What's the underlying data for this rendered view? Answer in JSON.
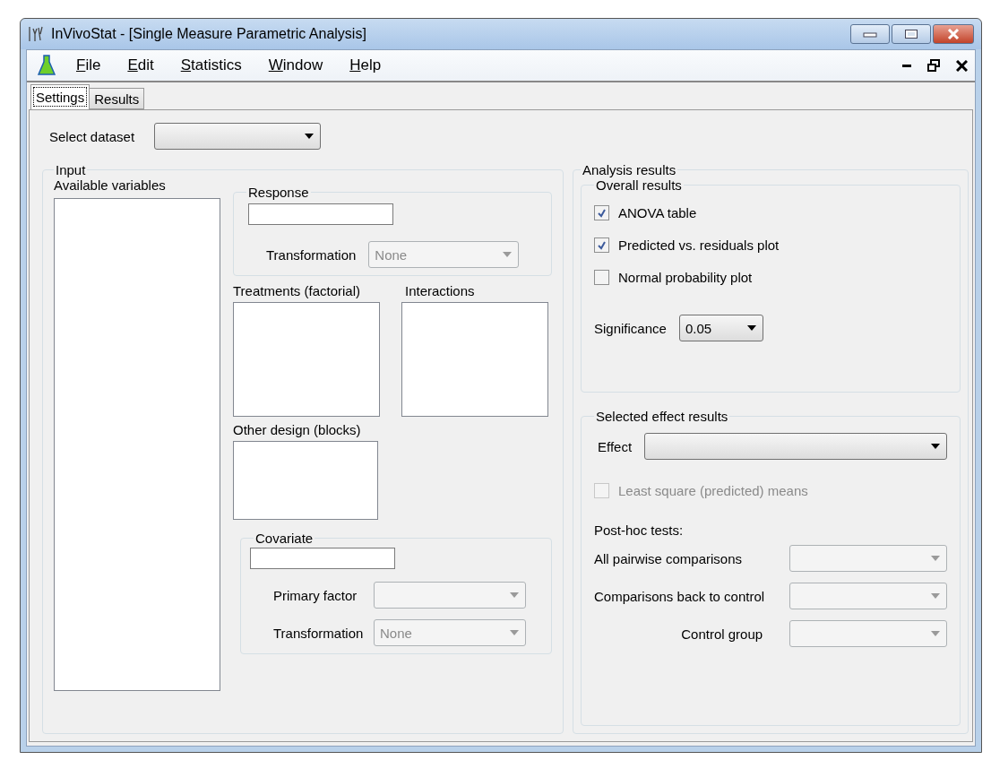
{
  "window": {
    "title": "InVivoStat - [Single Measure Parametric Analysis]"
  },
  "menu": [
    {
      "label": "File"
    },
    {
      "label": "Edit"
    },
    {
      "label": "Statistics"
    },
    {
      "label": "Window"
    },
    {
      "label": "Help"
    }
  ],
  "tabs": [
    {
      "label": "Settings",
      "selected": true
    },
    {
      "label": "Results",
      "selected": false
    }
  ],
  "select_dataset": {
    "label": "Select dataset",
    "disabled": false
  },
  "input": {
    "title": "Input",
    "available_variables": {
      "label": "Available variables"
    },
    "response": {
      "title": "Response",
      "transformation": {
        "label": "Transformation",
        "value": "None",
        "disabled": true
      }
    },
    "treatments": {
      "label": "Treatments (factorial)"
    },
    "interactions": {
      "label": "Interactions"
    },
    "other_design": {
      "label": "Other design (blocks)"
    },
    "covariate": {
      "title": "Covariate",
      "primary_factor": {
        "label": "Primary factor",
        "disabled": true
      },
      "transformation": {
        "label": "Transformation",
        "value": "None",
        "disabled": true
      }
    }
  },
  "analysis_results": {
    "title": "Analysis results",
    "overall_results": {
      "title": "Overall results",
      "options": [
        {
          "label": "ANOVA table",
          "checked": true,
          "disabled": false
        },
        {
          "label": "Predicted vs. residuals plot",
          "checked": true,
          "disabled": false
        },
        {
          "label": "Normal probability plot",
          "checked": false,
          "disabled": false
        }
      ],
      "significance": {
        "label": "Significance",
        "value": "0.05",
        "disabled": false
      }
    },
    "selected_effect_results": {
      "title": "Selected effect results",
      "effect": {
        "label": "Effect",
        "disabled": false
      },
      "least_square_means": {
        "label": "Least square (predicted) means",
        "checked": false,
        "disabled": true
      },
      "post_hoc_label": "Post-hoc tests:",
      "tests": [
        {
          "label": "All pairwise comparisons",
          "disabled": true
        },
        {
          "label": "Comparisons back to control",
          "disabled": true
        },
        {
          "label": "Control group",
          "disabled": true
        }
      ]
    }
  }
}
